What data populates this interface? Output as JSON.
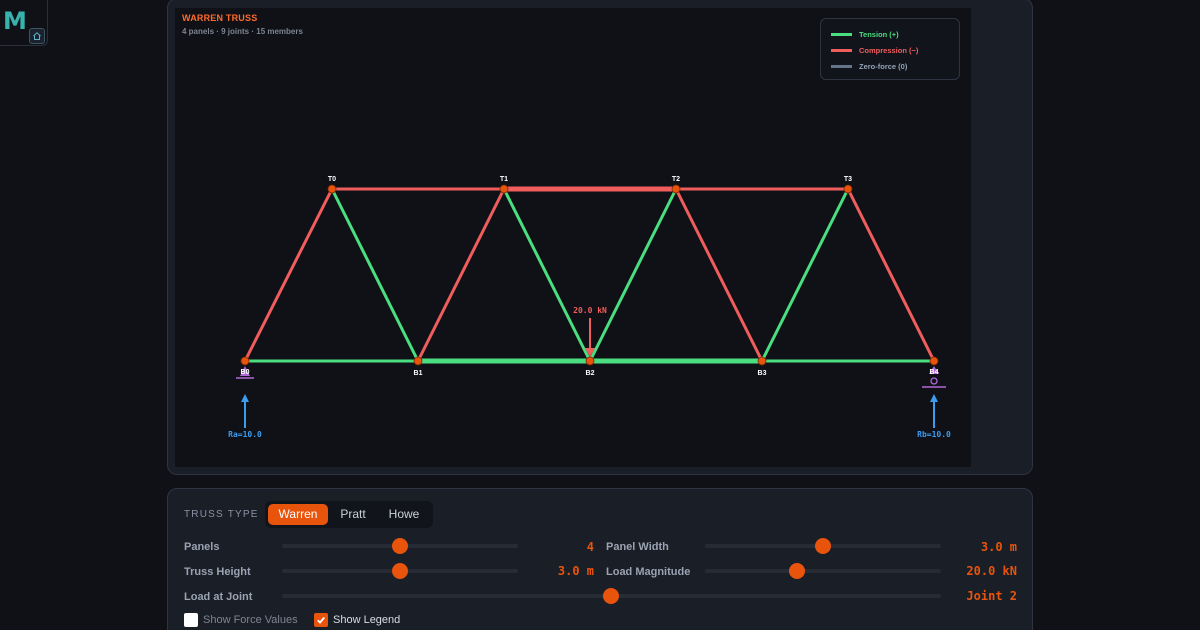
{
  "logo": {
    "letter": "M"
  },
  "canvas": {
    "title": "WARREN TRUSS",
    "subtitle": "4 panels · 9 joints · 15 members"
  },
  "legend": {
    "items": [
      {
        "label": "Tension (+)",
        "color": "#4ade80"
      },
      {
        "label": "Compression (−)",
        "color": "#f05d5d"
      },
      {
        "label": "Zero-force (0)",
        "color": "#64748b"
      }
    ]
  },
  "truss": {
    "top_joints": [
      "T0",
      "T1",
      "T2",
      "T3"
    ],
    "bottom_joints": [
      "B0",
      "B1",
      "B2",
      "B3",
      "B4"
    ],
    "load_label": "20.0 kN",
    "reaction_left": "Ra=10.0",
    "reaction_right": "Rb=10.0",
    "colors": {
      "tension": "#4ade80",
      "compression": "#f05d5d",
      "joint": "#e8540c",
      "support": "#b267d8",
      "reaction": "#3b9cf0",
      "load": "#f05d5d"
    }
  },
  "controls": {
    "truss_type_label": "TRUSS TYPE",
    "types": [
      "Warren",
      "Pratt",
      "Howe"
    ],
    "active_type": "Warren",
    "panels": {
      "label": "Panels",
      "value": "4",
      "fraction": 0.5
    },
    "panel_width": {
      "label": "Panel Width",
      "value": "3.0 m",
      "fraction": 0.5
    },
    "truss_height": {
      "label": "Truss Height",
      "value": "3.0 m",
      "fraction": 0.5
    },
    "load_magnitude": {
      "label": "Load Magnitude",
      "value": "20.0 kN",
      "fraction": 0.4
    },
    "load_joint": {
      "label": "Load at Joint",
      "value": "Joint 2",
      "fraction": 0.5
    },
    "show_force_values": {
      "label": "Show Force Values",
      "checked": false
    },
    "show_legend": {
      "label": "Show Legend",
      "checked": true
    }
  }
}
